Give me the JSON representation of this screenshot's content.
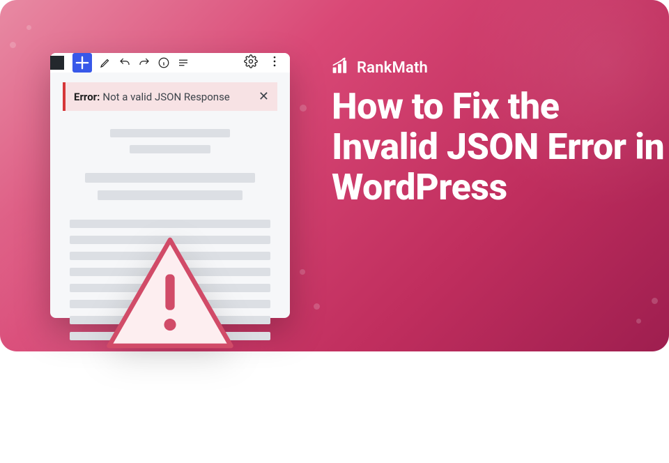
{
  "brand": {
    "name": "RankMath"
  },
  "headline": "How to Fix the Invalid JSON Error in WordPress",
  "editor": {
    "error_label": "Error:",
    "error_message": "Not a valid JSON Response"
  },
  "icons": {
    "add": "plus-icon",
    "edit": "pencil-icon",
    "undo": "undo-icon",
    "redo": "redo-icon",
    "info": "info-icon",
    "list": "list-icon",
    "settings": "gear-icon",
    "menu": "dots-icon",
    "close": "close-icon",
    "warning": "warning-triangle-icon"
  }
}
